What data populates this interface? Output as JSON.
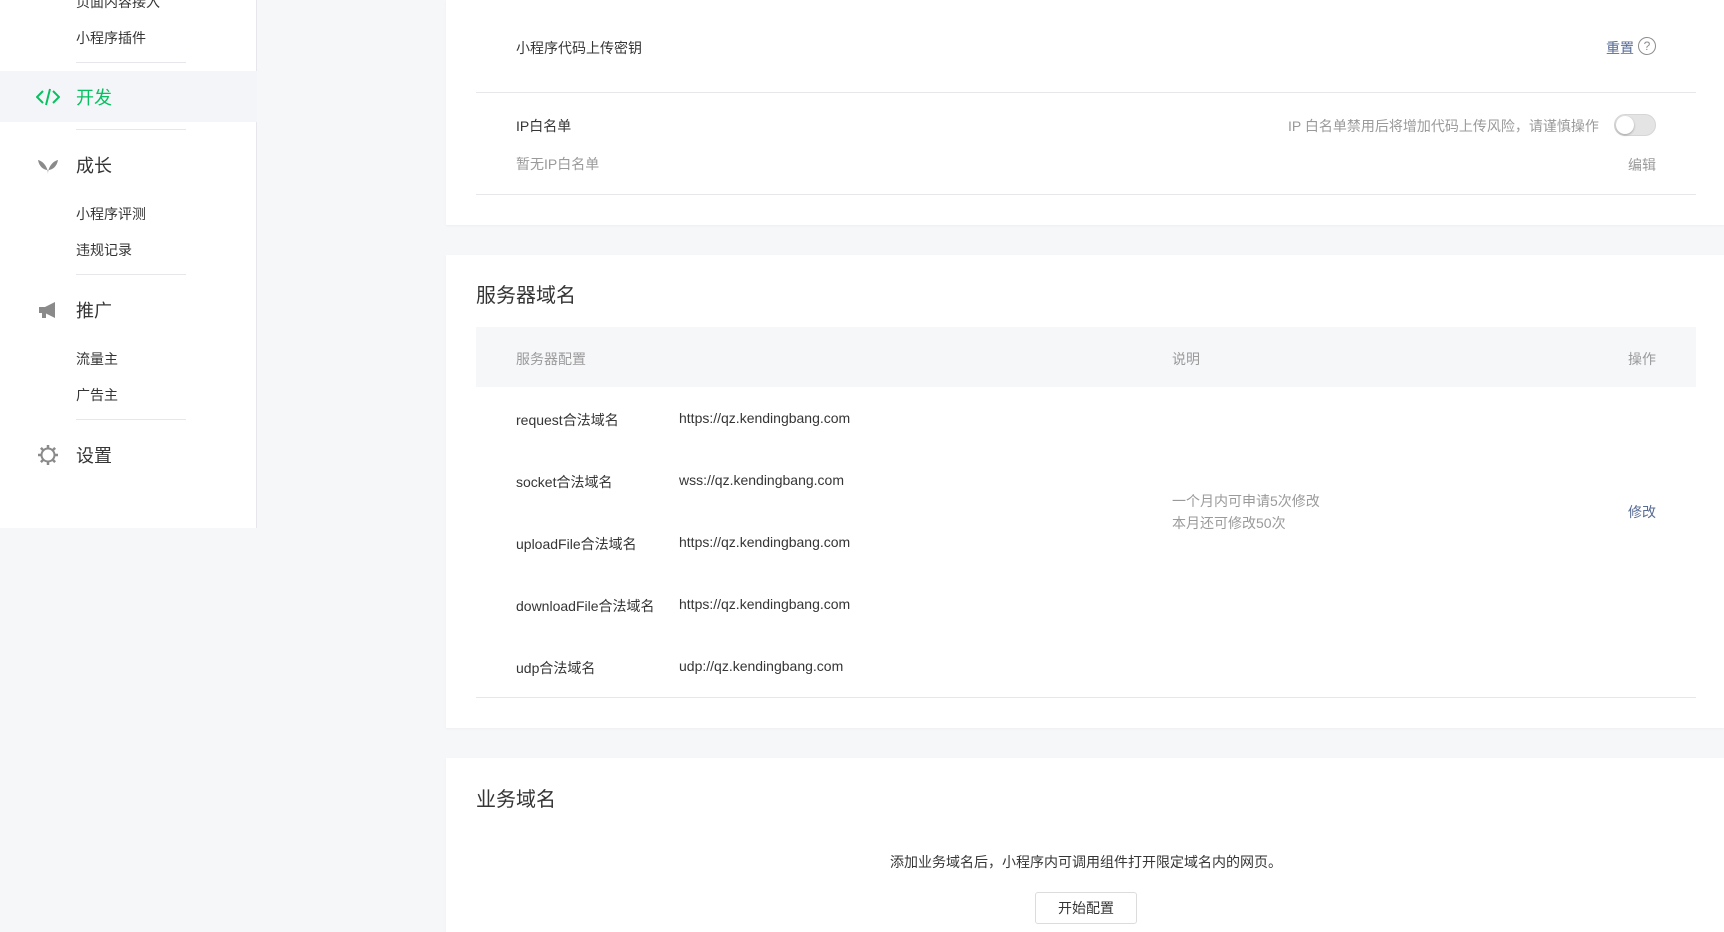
{
  "sidebar": {
    "top_partial_label": "页面内容接入",
    "plugin_label": "小程序插件",
    "dev_label": "开发",
    "growth_label": "成长",
    "growth_items": [
      "小程序评测",
      "违规记录"
    ],
    "promo_label": "推广",
    "promo_items": [
      "流量主",
      "广告主"
    ],
    "settings_label": "设置"
  },
  "upload_key": {
    "label": "小程序代码上传密钥",
    "reset_label": "重置",
    "help_icon": "?"
  },
  "ip_whitelist": {
    "label": "IP白名单",
    "warning": "IP 白名单禁用后将增加代码上传风险，请谨慎操作",
    "empty_text": "暂无IP白名单",
    "edit_label": "编辑",
    "toggle_on": false
  },
  "server_domain": {
    "title": "服务器域名",
    "headers": {
      "config": "服务器配置",
      "desc": "说明",
      "op": "操作"
    },
    "rows": [
      {
        "name": "request合法域名",
        "value": "https://qz.kendingbang.com"
      },
      {
        "name": "socket合法域名",
        "value": "wss://qz.kendingbang.com"
      },
      {
        "name": "uploadFile合法域名",
        "value": "https://qz.kendingbang.com"
      },
      {
        "name": "downloadFile合法域名",
        "value": "https://qz.kendingbang.com"
      },
      {
        "name": "udp合法域名",
        "value": "udp://qz.kendingbang.com"
      }
    ],
    "desc_line1": "一个月内可申请5次修改",
    "desc_line2": "本月还可修改50次",
    "modify_label": "修改"
  },
  "business_domain": {
    "title": "业务域名",
    "desc": "添加业务域名后，小程序内可调用组件打开限定域名内的网页。",
    "start_label": "开始配置"
  },
  "colors": {
    "accent": "#07c160",
    "link": "#576b95"
  }
}
